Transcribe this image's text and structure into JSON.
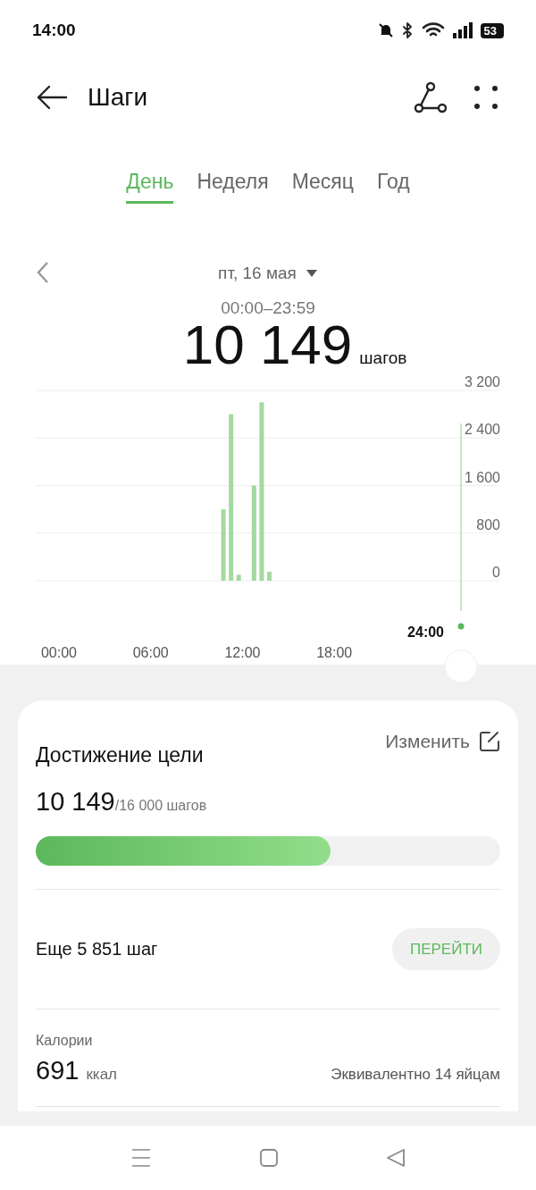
{
  "status_bar": {
    "time": "14:00",
    "battery": "53"
  },
  "header": {
    "title": "Шаги"
  },
  "tabs": [
    {
      "label": "День",
      "selected": true
    },
    {
      "label": "Неделя",
      "selected": false
    },
    {
      "label": "Месяц",
      "selected": false
    },
    {
      "label": "Год",
      "selected": false
    }
  ],
  "date": {
    "label": "пт, 16 мая",
    "range": "00:00–23:59"
  },
  "total": {
    "value": "10 149",
    "unit": "шагов"
  },
  "chart": {
    "cursor_label": "24:00",
    "chart_data": {
      "type": "bar",
      "grid": true,
      "x": [
        10.75,
        11.25,
        11.75,
        12.75,
        13.25,
        13.75
      ],
      "values": [
        1200,
        2800,
        100,
        1600,
        3000,
        150
      ],
      "xlim": [
        -1.5,
        28.8
      ],
      "ylim": [
        0,
        3200
      ],
      "xticks": [
        {
          "value": 0,
          "label": "00:00"
        },
        {
          "value": 6,
          "label": "06:00"
        },
        {
          "value": 12,
          "label": "12:00"
        },
        {
          "value": 18,
          "label": "18:00"
        }
      ],
      "yticks": [
        {
          "value": 0,
          "label": "0"
        },
        {
          "value": 800,
          "label": "800"
        },
        {
          "value": 1600,
          "label": "1 600"
        },
        {
          "value": 2400,
          "label": "2 400"
        },
        {
          "value": 3200,
          "label": "3 200"
        }
      ]
    }
  },
  "goal": {
    "title": "Достижение цели",
    "edit": "Изменить",
    "value": "10 149",
    "target": "/16 000 шагов",
    "level": 0.634,
    "remaining": "Еще 5 851 шаг",
    "action": "ПЕРЕЙТИ"
  },
  "calories": {
    "label": "Калории",
    "value": "691",
    "unit": "ккал",
    "note": "Эквивалентно 14 яйцам"
  }
}
